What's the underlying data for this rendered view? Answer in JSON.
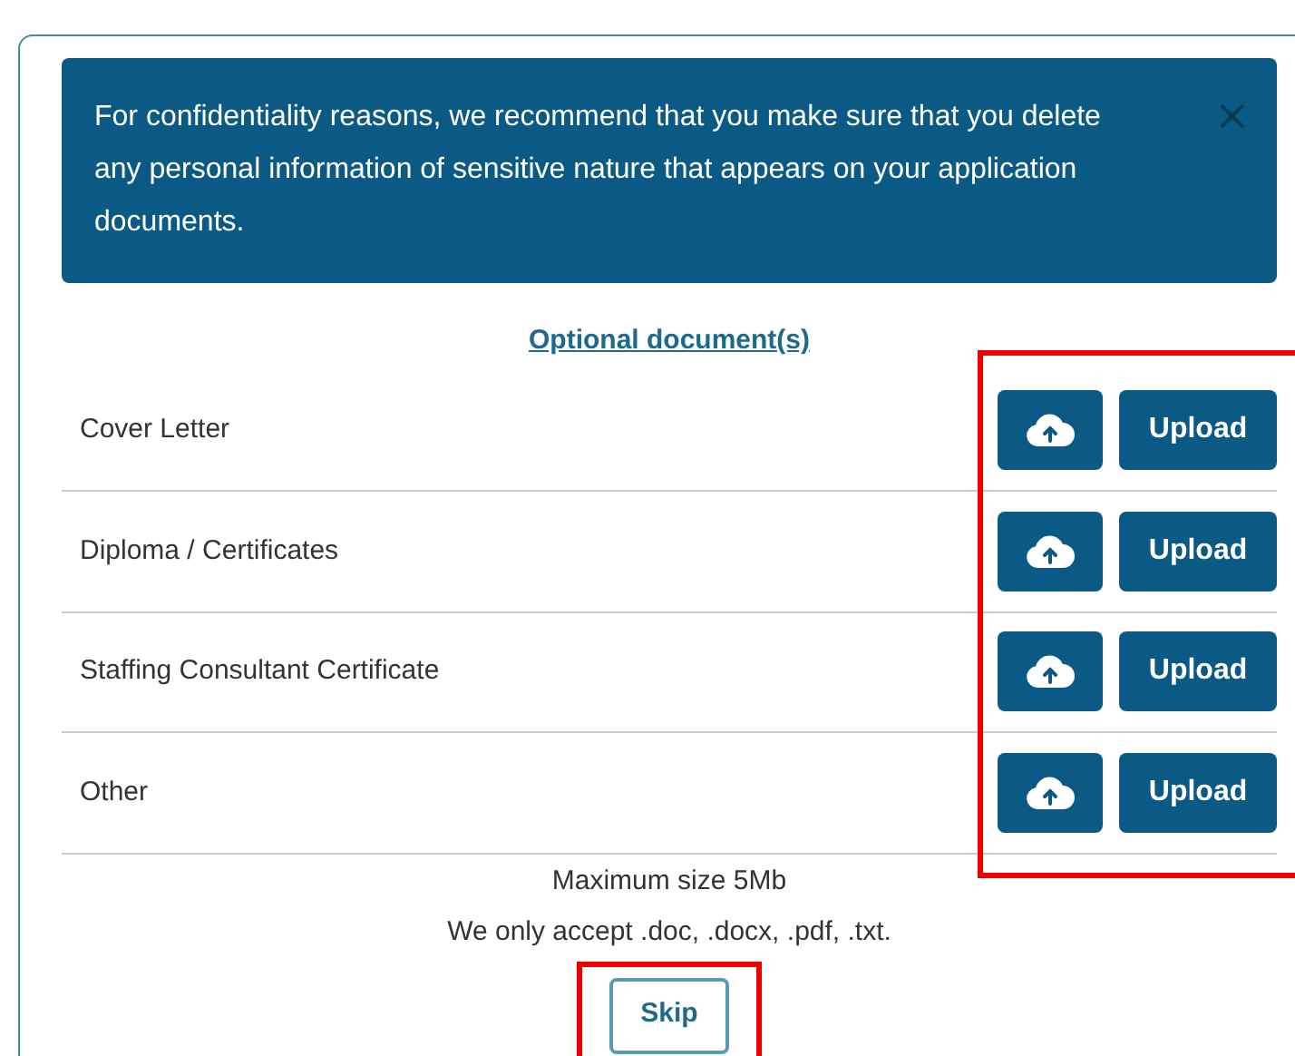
{
  "notice": {
    "text": "For confidentiality reasons, we recommend that you make sure that you delete any personal information of sensitive nature that appears on your application documents.",
    "close": "×"
  },
  "section_title": "Optional document(s)",
  "documents": [
    {
      "label": "Cover Letter",
      "button": "Upload"
    },
    {
      "label": "Diploma / Certificates",
      "button": "Upload"
    },
    {
      "label": "Staffing Consultant Certificate",
      "button": "Upload"
    },
    {
      "label": "Other",
      "button": "Upload"
    }
  ],
  "footer": [
    "Maximum size 5Mb",
    "We only accept .doc, .docx, .pdf, .txt."
  ],
  "skip_button": "Skip"
}
